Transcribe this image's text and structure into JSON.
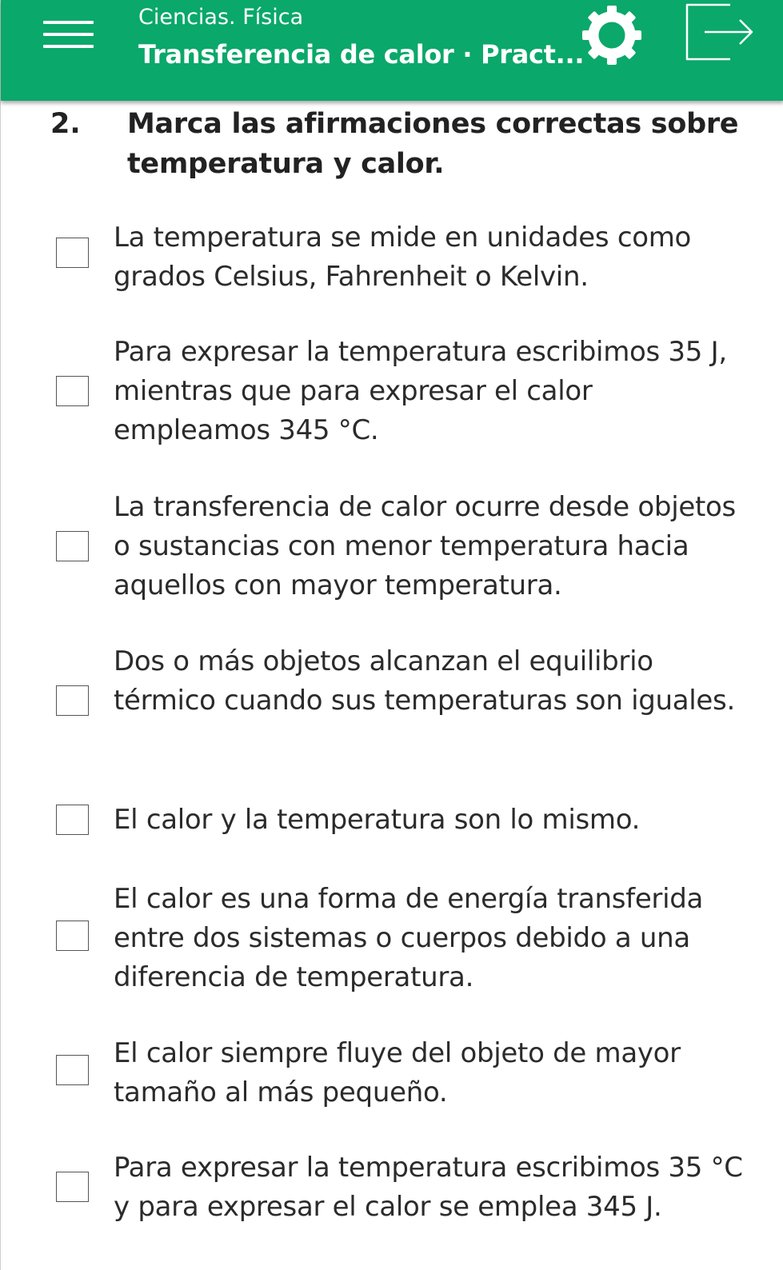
{
  "header": {
    "subject": "Ciencias. Física",
    "title": "Transferencia de calor · Pract...",
    "icons": {
      "menu": "hamburger-menu-icon",
      "settings": "gear-icon",
      "logout": "logout-icon"
    },
    "color": "#0aa86a"
  },
  "question": {
    "number": "2.",
    "text": "Marca las afirmaciones correctas sobre temperatura y calor."
  },
  "options": [
    {
      "label": "La temperatura se mide en unidades como grados Celsius, Fahrenheit o Kelvin.",
      "checked": false
    },
    {
      "label": "Para expresar la temperatura escribimos 35 J, mientras que para expresar el calor empleamos 345 °C.",
      "checked": false
    },
    {
      "label": "La transferencia de calor ocurre desde objetos o sustancias con menor temperatura hacia aquellos con mayor temperatura.",
      "checked": false
    },
    {
      "label": "Dos o más objetos alcanzan el equilibrio térmico cuando sus temperaturas son iguales.",
      "checked": false
    },
    {
      "label": "El calor y la temperatura son lo mismo.",
      "checked": false
    },
    {
      "label": "El calor es una forma de energía transferida entre dos sistemas o cuerpos debido a una diferencia de temperatura.",
      "checked": false
    },
    {
      "label": "El calor siempre fluye del objeto de mayor tamaño al más pequeño.",
      "checked": false
    },
    {
      "label": "Para expresar la temperatura escribimos 35 °C y para expresar el calor se emplea 345 J.",
      "checked": false
    }
  ]
}
